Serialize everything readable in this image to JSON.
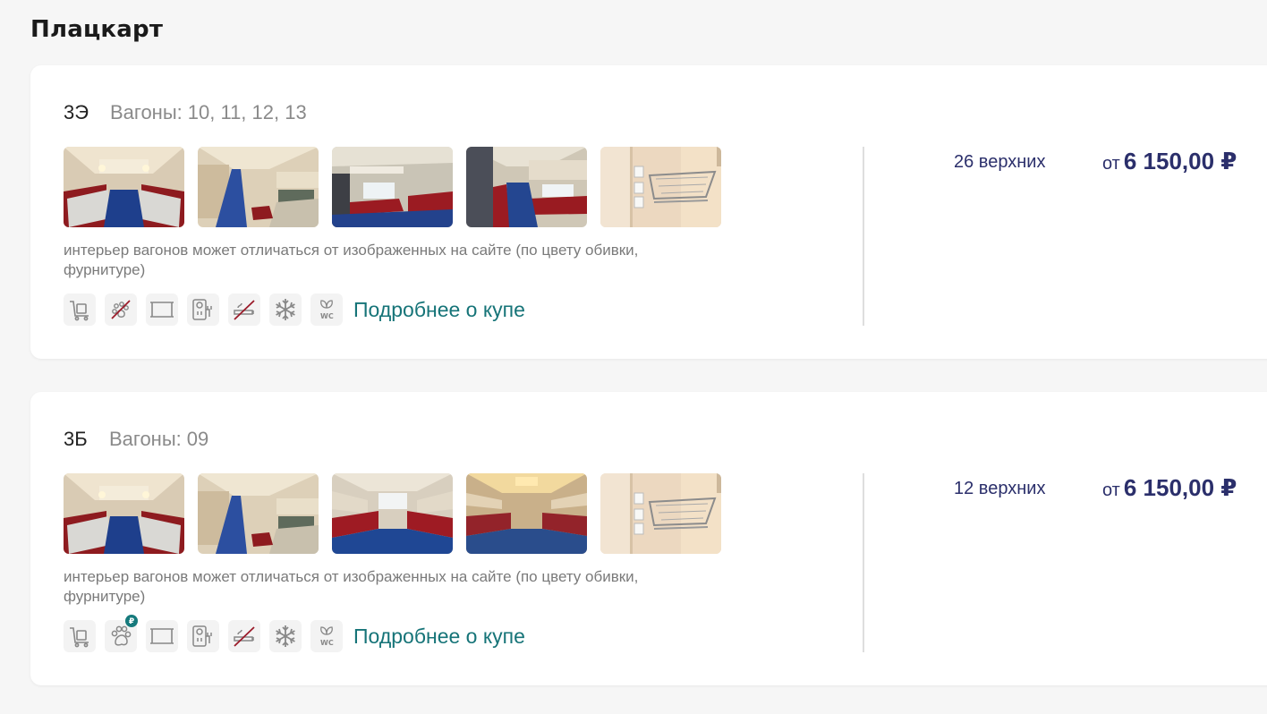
{
  "section": {
    "title": "Плацкарт"
  },
  "colors": {
    "accent_link": "#167478",
    "price_text": "#2b2f6b",
    "badge_bg": "#167a7c"
  },
  "cars": [
    {
      "class_code": "3Э",
      "wagons_label": "Вагоны:",
      "wagons_numbers": "10, 11, 12, 13",
      "photos": [
        "berths-red",
        "corridor-beige",
        "side-berths-red",
        "corridor-wide",
        "luggage-rack"
      ],
      "note": "интерьер вагонов может отличаться от изображенных на сайте (по цвету обивки, фурнитуре)",
      "amenities": [
        "luggage-cart-icon",
        "no-pets-icon",
        "bed-linen-icon",
        "power-outlet-icon",
        "no-smoking-icon",
        "air-conditioning-icon",
        "eco-wc-icon"
      ],
      "more_link": "Подробнее о купе",
      "seats_text": "26 верхних",
      "price_from": "от",
      "price_value": "6 150,00 ₽"
    },
    {
      "class_code": "3Б",
      "wagons_label": "Вагоны:",
      "wagons_numbers": "09",
      "photos": [
        "berths-red",
        "corridor-beige",
        "compartment-red-blue",
        "compartment-warm-light",
        "luggage-rack"
      ],
      "note": "интерьер вагонов может отличаться от изображенных на сайте (по цвету обивки, фурнитуре)",
      "amenities": [
        "luggage-cart-icon",
        "pets-allowed-icon",
        "bed-linen-icon",
        "power-outlet-icon",
        "no-smoking-icon",
        "air-conditioning-icon",
        "eco-wc-icon"
      ],
      "pets_badge": "₽",
      "more_link": "Подробнее о купе",
      "seats_text": "12 верхних",
      "price_from": "от",
      "price_value": "6 150,00 ₽"
    }
  ]
}
